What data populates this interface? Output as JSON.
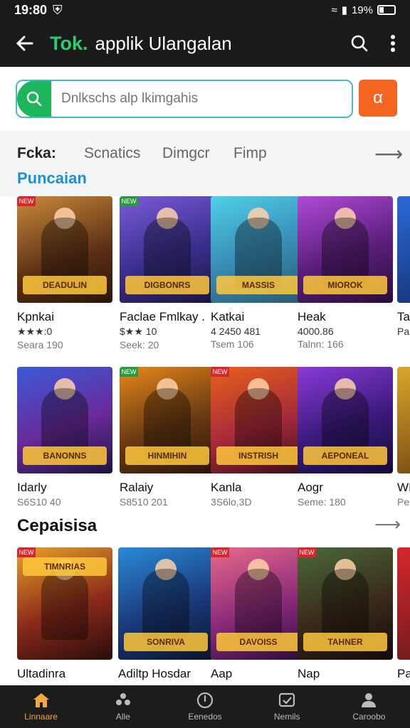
{
  "status_bar": {
    "time": "19:80",
    "battery": "19%"
  },
  "app_bar": {
    "brand": "Tok.",
    "title": "applik Ulangalan"
  },
  "search": {
    "placeholder": "Dnlkschs alp lkimgahis"
  },
  "tabs": {
    "items": [
      "Fcka:",
      "Scnatics",
      "Dimgcr",
      "Fimp"
    ],
    "subtitle": "Puncaian"
  },
  "row1": [
    {
      "name": "Kpnkai",
      "rating": "★★★:0",
      "meta": "Seara 190",
      "logo": "DEADULIN"
    },
    {
      "name": "Faclae Fmlkay .",
      "rating": "$★★ 10",
      "meta": "Seek: 20",
      "logo": "DIGBONRS"
    },
    {
      "name": "Katkai",
      "rating": "4 2450 481",
      "meta": "Tsem 106",
      "logo": "MASSIS"
    },
    {
      "name": "Heak",
      "rating": "4000.86",
      "meta": "Talnn: 166",
      "logo": "MIOROK"
    },
    {
      "name": "Ta",
      "rating": "Pa",
      "meta": "",
      "logo": ""
    }
  ],
  "row2": [
    {
      "name": "Idarly",
      "rating": "",
      "meta": "S6S10 40",
      "logo": "BANONNS"
    },
    {
      "name": "Ralaiy",
      "rating": "",
      "meta": "S8510 201",
      "logo": "HINMIHIN"
    },
    {
      "name": "Kanla",
      "rating": "",
      "meta": "3S6lo,3D",
      "logo": "INSTRISH"
    },
    {
      "name": "Aogr",
      "rating": "",
      "meta": "Seme: 180",
      "logo": "AEPONEAL"
    },
    {
      "name": "WI",
      "rating": "",
      "meta": "Pe",
      "logo": ""
    }
  ],
  "section2": {
    "title": "Cepaisisa"
  },
  "row3": [
    {
      "name": "Ultadinra",
      "logo": "TIMNRIAS"
    },
    {
      "name": "Adiltp Hosdar",
      "logo": "SONRIVA"
    },
    {
      "name": "Aap",
      "logo": "DAVOISS"
    },
    {
      "name": "Nap",
      "logo": "TAHNER"
    },
    {
      "name": "Pa",
      "logo": ""
    }
  ],
  "bottom_nav": [
    {
      "label": "Linnaare",
      "icon": "home-icon"
    },
    {
      "label": "Alle",
      "icon": "apps-icon"
    },
    {
      "label": "Eenedos",
      "icon": "clock-icon"
    },
    {
      "label": "Nemils",
      "icon": "inbox-icon"
    },
    {
      "label": "Caroobo",
      "icon": "profile-icon"
    }
  ],
  "colors": {
    "accent": "#1eb65a",
    "filter": "#f26622",
    "link": "#1b8ee0",
    "nav_active": "#f0a83a"
  }
}
